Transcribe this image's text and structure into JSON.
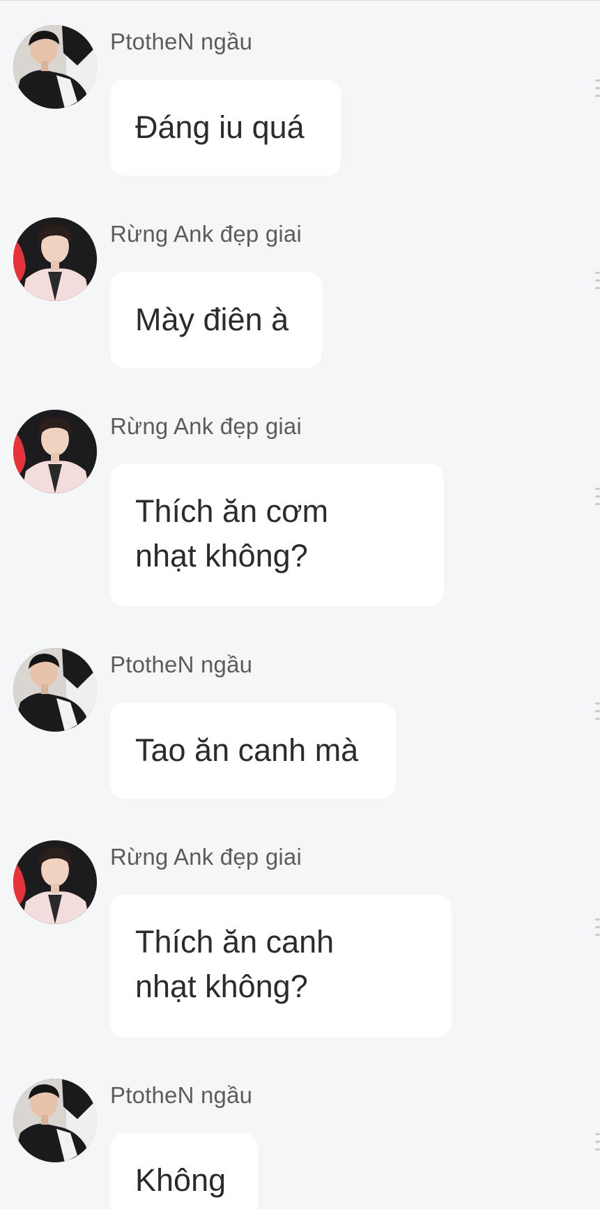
{
  "chat": {
    "messages": [
      {
        "sender": "PtotheN ngầu",
        "text": "Đáng iu quá",
        "avatar": "avatar-ptothen"
      },
      {
        "sender": "Rừng Ank đẹp giai",
        "text": "Mày điên à",
        "avatar": "avatar-rung-ank"
      },
      {
        "sender": "Rừng Ank đẹp giai",
        "text": "Thích ăn cơm\nnhạt không?",
        "avatar": "avatar-rung-ank"
      },
      {
        "sender": "PtotheN ngầu",
        "text": "Tao ăn canh mà",
        "avatar": "avatar-ptothen"
      },
      {
        "sender": "Rừng Ank đẹp giai",
        "text": "Thích ăn canh\nnhạt không?",
        "avatar": "avatar-rung-ank"
      },
      {
        "sender": "PtotheN ngầu",
        "text": "Không",
        "avatar": "avatar-ptothen"
      }
    ]
  },
  "colors": {
    "background": "#f5f6f8",
    "bubble": "#ffffff",
    "sender_text": "#5c5c5c",
    "message_text": "#2b2b2b"
  },
  "icons": {
    "row_handle": "menu-handle-icon"
  }
}
